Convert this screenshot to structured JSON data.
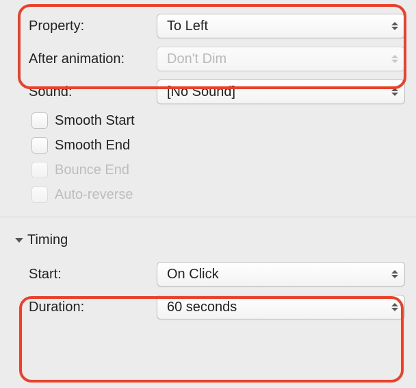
{
  "effect": {
    "property_label": "Property:",
    "property_value": "To Left",
    "after_animation_label": "After animation:",
    "after_animation_value": "Don't Dim",
    "sound_label": "Sound:",
    "sound_value": "[No Sound]",
    "smooth_start": "Smooth Start",
    "smooth_end": "Smooth End",
    "bounce_end": "Bounce End",
    "auto_reverse": "Auto-reverse"
  },
  "timing": {
    "section": "Timing",
    "start_label": "Start:",
    "start_value": "On Click",
    "duration_label": "Duration:",
    "duration_value": "60 seconds"
  }
}
